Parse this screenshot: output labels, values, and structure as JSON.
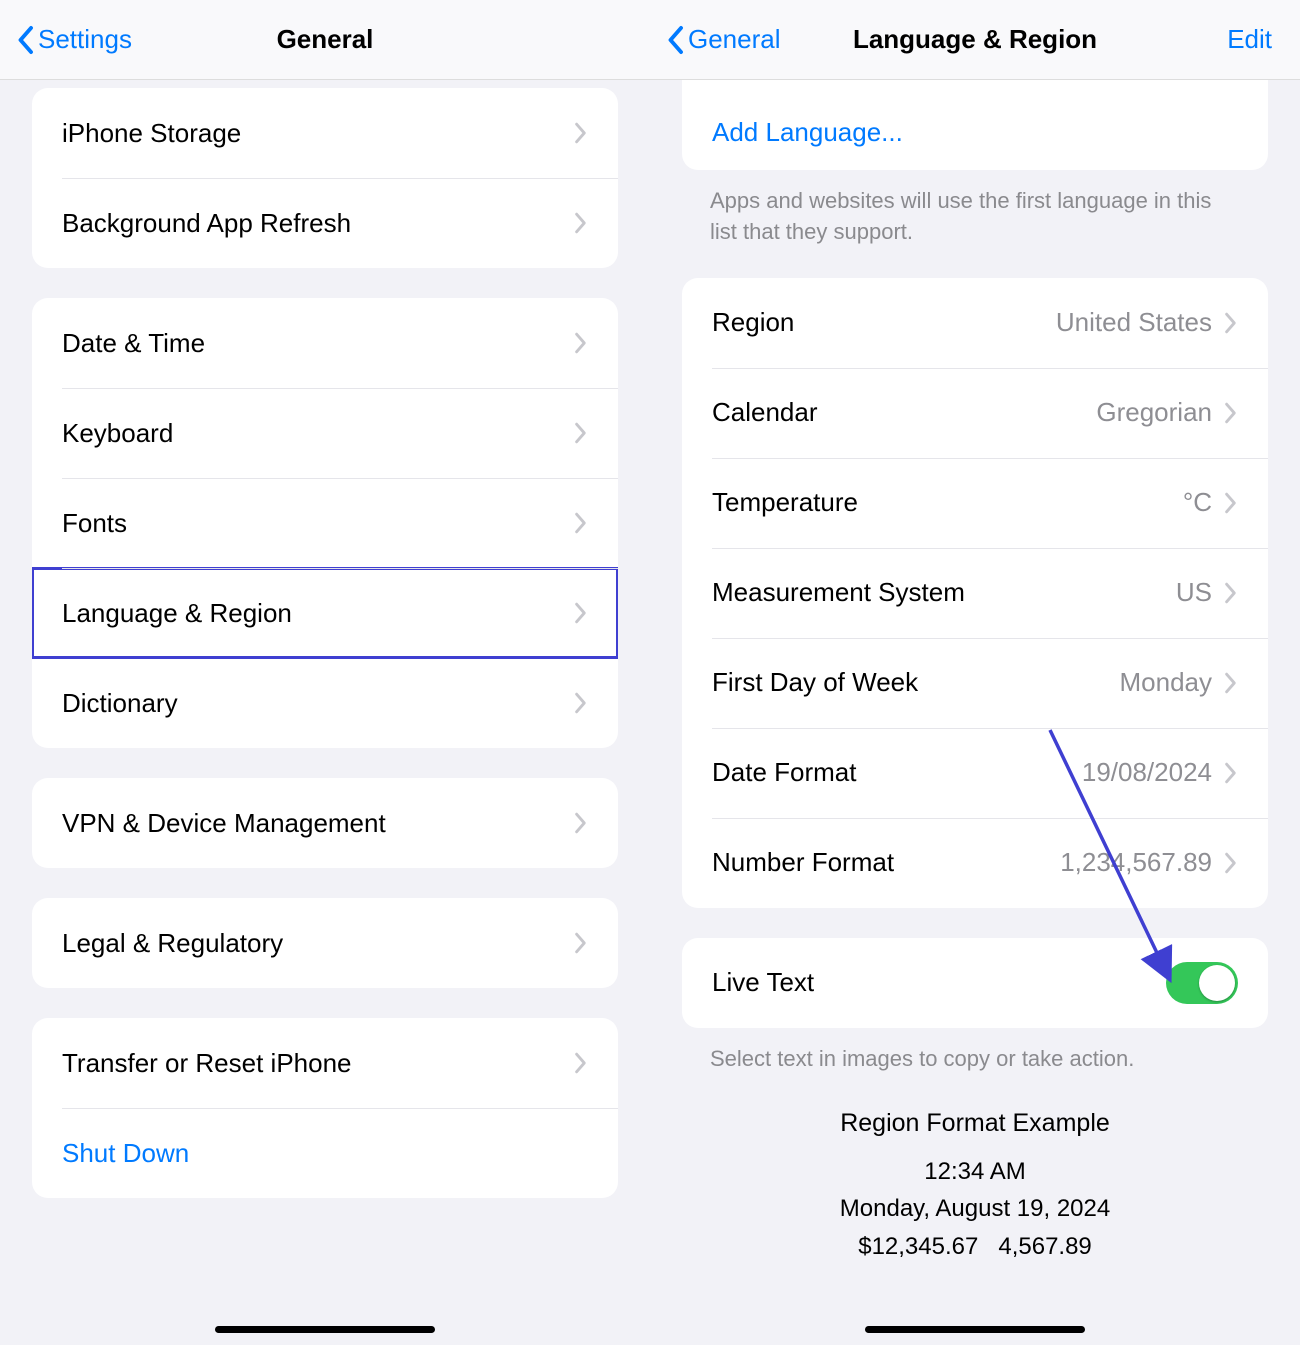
{
  "left": {
    "nav": {
      "back": "Settings",
      "title": "General"
    },
    "group1": {
      "items": [
        {
          "label": "iPhone Storage"
        },
        {
          "label": "Background App Refresh"
        }
      ]
    },
    "group2": {
      "items": [
        {
          "label": "Date & Time"
        },
        {
          "label": "Keyboard"
        },
        {
          "label": "Fonts"
        },
        {
          "label": "Language & Region",
          "highlighted": true
        },
        {
          "label": "Dictionary"
        }
      ]
    },
    "group3": {
      "items": [
        {
          "label": "VPN & Device Management"
        }
      ]
    },
    "group4": {
      "items": [
        {
          "label": "Legal & Regulatory"
        }
      ]
    },
    "group5": {
      "items": [
        {
          "label": "Transfer or Reset iPhone"
        },
        {
          "label": "Shut Down",
          "link": true
        }
      ]
    }
  },
  "right": {
    "nav": {
      "back": "General",
      "title": "Language & Region",
      "edit": "Edit"
    },
    "add_language": "Add Language...",
    "lang_footer": "Apps and websites will use the first language in this list that they support.",
    "region_group": {
      "items": [
        {
          "label": "Region",
          "value": "United States"
        },
        {
          "label": "Calendar",
          "value": "Gregorian"
        },
        {
          "label": "Temperature",
          "value": "°C"
        },
        {
          "label": "Measurement System",
          "value": "US"
        },
        {
          "label": "First Day of Week",
          "value": "Monday"
        },
        {
          "label": "Date Format",
          "value": "19/08/2024"
        },
        {
          "label": "Number Format",
          "value": "1,234,567.89"
        }
      ]
    },
    "live_text": {
      "label": "Live Text",
      "enabled": true
    },
    "live_text_footer": "Select text in images to copy or take action.",
    "example": {
      "title": "Region Format Example",
      "time": "12:34 AM",
      "date": "Monday, August 19, 2024",
      "currency": "$12,345.67",
      "number": "4,567.89"
    }
  }
}
